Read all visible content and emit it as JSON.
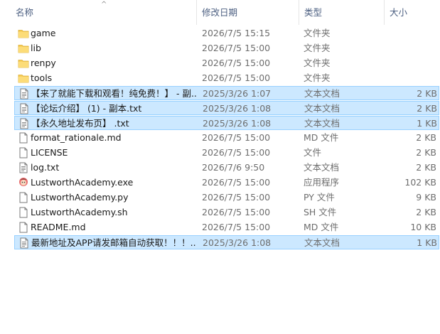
{
  "columns": {
    "name": "名称",
    "date": "修改日期",
    "type": "类型",
    "size": "大小"
  },
  "files": [
    {
      "name": "game",
      "date": "2026/7/5 15:15",
      "type": "文件夹",
      "size": "",
      "icon": "folder-icon",
      "selected": false
    },
    {
      "name": "lib",
      "date": "2026/7/5 15:00",
      "type": "文件夹",
      "size": "",
      "icon": "folder-icon",
      "selected": false
    },
    {
      "name": "renpy",
      "date": "2026/7/5 15:00",
      "type": "文件夹",
      "size": "",
      "icon": "folder-icon",
      "selected": false
    },
    {
      "name": "tools",
      "date": "2026/7/5 15:00",
      "type": "文件夹",
      "size": "",
      "icon": "folder-icon",
      "selected": false
    },
    {
      "name": "【来了就能下载和观看！纯免费！】 - 副...",
      "date": "2025/3/26 1:07",
      "type": "文本文档",
      "size": "2 KB",
      "icon": "text-document-icon",
      "selected": true
    },
    {
      "name": "【论坛介绍】 (1) - 副本.txt",
      "date": "2025/3/26 1:08",
      "type": "文本文档",
      "size": "2 KB",
      "icon": "text-document-icon",
      "selected": true
    },
    {
      "name": "【永久地址发布页】 .txt",
      "date": "2025/3/26 1:08",
      "type": "文本文档",
      "size": "1 KB",
      "icon": "text-document-icon",
      "selected": true
    },
    {
      "name": "format_rationale.md",
      "date": "2026/7/5 15:00",
      "type": "MD 文件",
      "size": "2 KB",
      "icon": "file-icon",
      "selected": false
    },
    {
      "name": "LICENSE",
      "date": "2026/7/5 15:00",
      "type": "文件",
      "size": "2 KB",
      "icon": "file-icon",
      "selected": false
    },
    {
      "name": "log.txt",
      "date": "2026/7/6 9:50",
      "type": "文本文档",
      "size": "2 KB",
      "icon": "text-document-icon",
      "selected": false
    },
    {
      "name": "LustworthAcademy.exe",
      "date": "2026/7/5 15:00",
      "type": "应用程序",
      "size": "102 KB",
      "icon": "app-icon",
      "selected": false
    },
    {
      "name": "LustworthAcademy.py",
      "date": "2026/7/5 15:00",
      "type": "PY 文件",
      "size": "9 KB",
      "icon": "file-icon",
      "selected": false
    },
    {
      "name": "LustworthAcademy.sh",
      "date": "2026/7/5 15:00",
      "type": "SH 文件",
      "size": "2 KB",
      "icon": "file-icon",
      "selected": false
    },
    {
      "name": "README.md",
      "date": "2026/7/5 15:00",
      "type": "MD 文件",
      "size": "10 KB",
      "icon": "file-icon",
      "selected": false
    },
    {
      "name": "最新地址及APP请发邮箱自动获取！！！...",
      "date": "2025/3/26 1:08",
      "type": "文本文档",
      "size": "1 KB",
      "icon": "text-document-icon",
      "selected": true
    }
  ]
}
